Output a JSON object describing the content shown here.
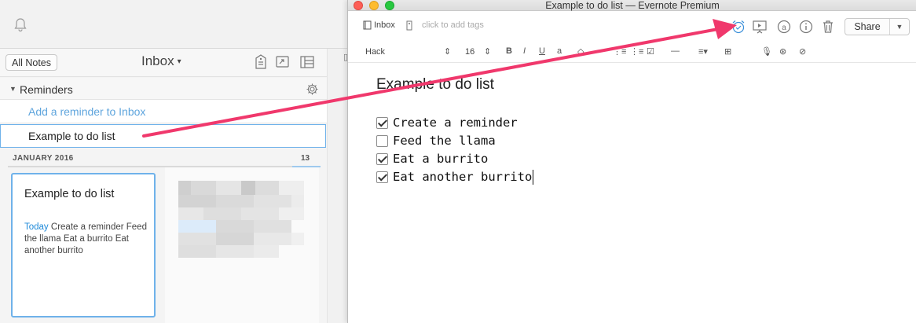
{
  "left_app": {
    "all_notes_label": "All Notes",
    "notebook_title": "Inbox",
    "reminders_label": "Reminders",
    "add_reminder_placeholder": "Add a reminder to Inbox",
    "reminder_item": "Example to do list",
    "month_header": "JANUARY 2016",
    "month_count": "13",
    "note_card": {
      "title": "Example to do list",
      "date": "Today",
      "snippet": "Create a reminder Feed the llama Eat a burrito Eat another burrito"
    }
  },
  "note_window": {
    "window_title": "Example to do list — Evernote Premium",
    "notebook_label": "Inbox",
    "tags_placeholder": "click to add tags",
    "share_label": "Share",
    "format": {
      "font_name": "Hack",
      "font_size": "16"
    },
    "note_title": "Example to do list",
    "checklist": [
      {
        "text": "Create a reminder",
        "checked": true
      },
      {
        "text": "Feed the llama",
        "checked": false
      },
      {
        "text": "Eat a burrito",
        "checked": true
      },
      {
        "text": "Eat another burrito",
        "checked": true
      }
    ]
  },
  "colors": {
    "accent_blue": "#1f8ad9",
    "selection_blue": "#6fb2ea",
    "annotation_arrow": "#f0386c"
  }
}
